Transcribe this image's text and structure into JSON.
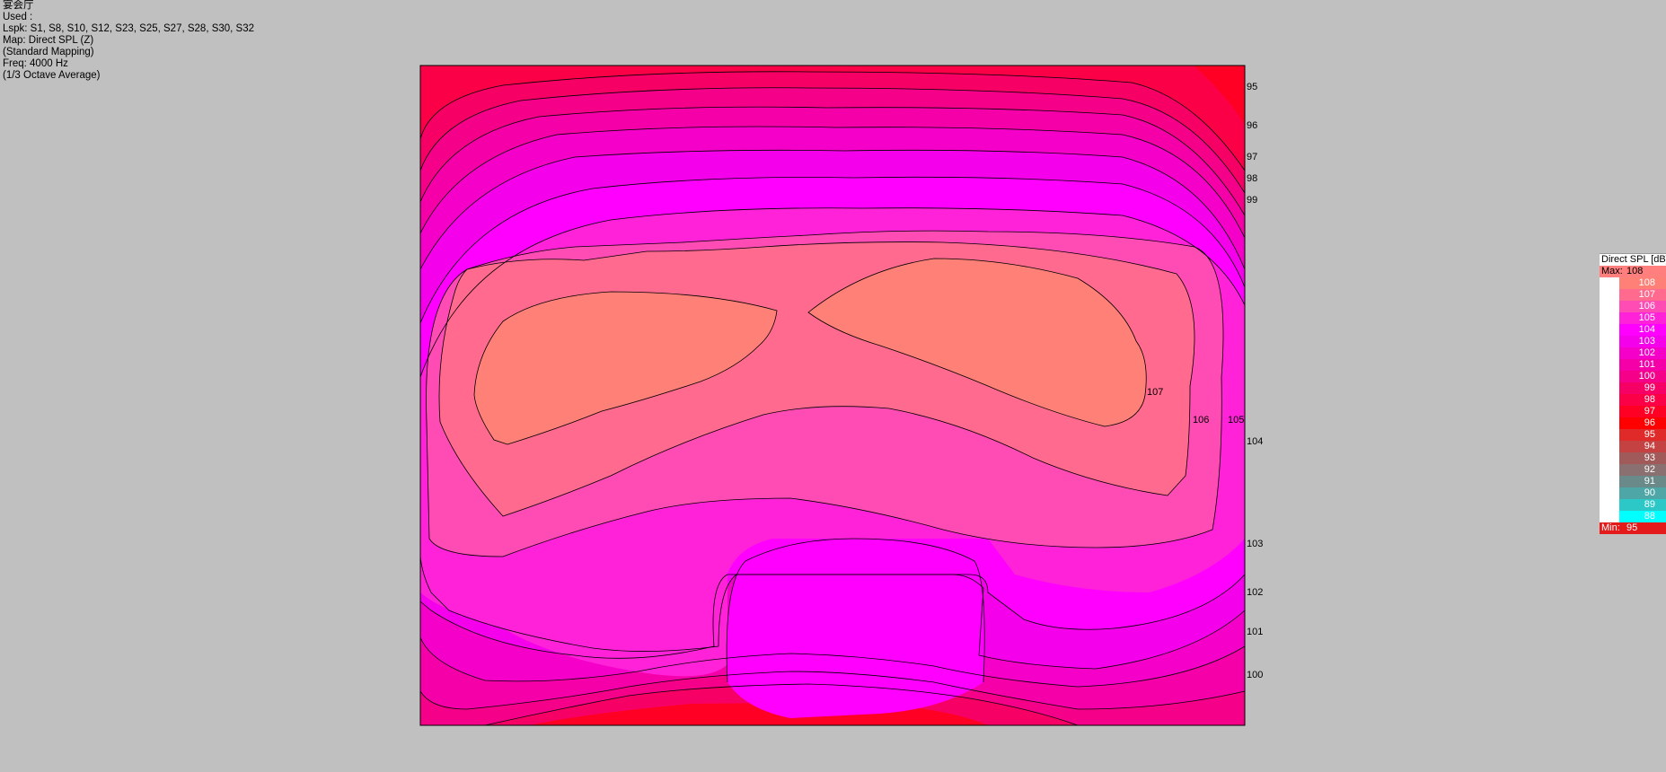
{
  "info": {
    "room": "宴会厅",
    "used": "Used :",
    "lspk": "Lspk: S1, S8, S10, S12, S23, S25, S27, S28, S30, S32",
    "map": "Map: Direct SPL (Z)",
    "mapping": "(Standard Mapping)",
    "freq": "Freq: 4000 Hz",
    "average": "(1/3 Octave Average)"
  },
  "legend": {
    "title": "Direct SPL [dB]",
    "max_label": "Max:",
    "max_value": "108",
    "min_label": "Min:",
    "min_value": "95",
    "max_color": "#ff7f7f",
    "min_color": "#e31b1b",
    "items": [
      {
        "value": "108",
        "color": "#ff8077"
      },
      {
        "value": "107",
        "color": "#ff6a8e"
      },
      {
        "value": "106",
        "color": "#ff4cb4"
      },
      {
        "value": "105",
        "color": "#ff22d8"
      },
      {
        "value": "104",
        "color": "#ff00ff"
      },
      {
        "value": "103",
        "color": "#f500ea"
      },
      {
        "value": "102",
        "color": "#f500c8"
      },
      {
        "value": "101",
        "color": "#f500a8"
      },
      {
        "value": "100",
        "color": "#f50088"
      },
      {
        "value": "99",
        "color": "#f70066"
      },
      {
        "value": "98",
        "color": "#fb0046"
      },
      {
        "value": "97",
        "color": "#ff0024"
      },
      {
        "value": "96",
        "color": "#ff0000"
      },
      {
        "value": "95",
        "color": "#e02a2a"
      },
      {
        "value": "94",
        "color": "#c44242"
      },
      {
        "value": "93",
        "color": "#a05a5a"
      },
      {
        "value": "92",
        "color": "#8a7070"
      },
      {
        "value": "91",
        "color": "#6a8a8a"
      },
      {
        "value": "90",
        "color": "#4ea6a6"
      },
      {
        "value": "89",
        "color": "#2cc8c8"
      },
      {
        "value": "88",
        "color": "#00ffff"
      }
    ]
  },
  "chart_data": {
    "type": "heatmap",
    "title": "",
    "unit": "dB",
    "max": 108,
    "min": 95,
    "contour_levels": [
      108,
      107,
      106,
      105,
      104,
      103,
      102,
      101,
      100,
      99,
      98,
      97,
      96,
      95
    ],
    "contour_labels": [
      "95",
      "96",
      "97",
      "98",
      "99",
      "104",
      "103",
      "102",
      "101",
      "100",
      "107",
      "106",
      "105"
    ]
  }
}
